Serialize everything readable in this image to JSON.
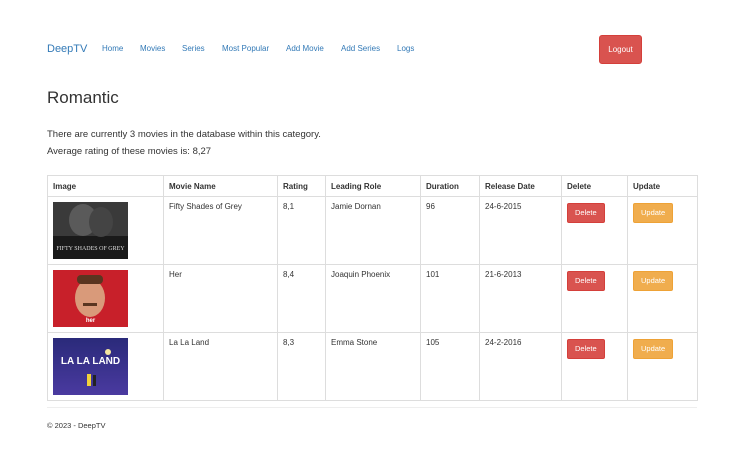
{
  "navbar": {
    "brand": "DeepTV",
    "links": [
      "Home",
      "Movies",
      "Series",
      "Most Popular",
      "Add Movie",
      "Add Series",
      "Logs"
    ],
    "logout_label": "Logout"
  },
  "page": {
    "title": "Romantic",
    "info_count": "There are currently 3 movies in the database within this category.",
    "info_rating": "Average rating of these movies is: 8,27"
  },
  "table": {
    "headers": [
      "Image",
      "Movie Name",
      "Rating",
      "Leading Role",
      "Duration",
      "Release Date",
      "Delete",
      "Update"
    ],
    "rows": [
      {
        "name": "Fifty Shades of Grey",
        "rating": "8,1",
        "role": "Jamie Dornan",
        "duration": "96",
        "release": "24-6-2015",
        "delete": "Delete",
        "update": "Update",
        "poster_text": "FIFTY SHADES OF GREY"
      },
      {
        "name": "Her",
        "rating": "8,4",
        "role": "Joaquin Phoenix",
        "duration": "101",
        "release": "21-6-2013",
        "delete": "Delete",
        "update": "Update",
        "poster_text": "her"
      },
      {
        "name": "La La Land",
        "rating": "8,3",
        "role": "Emma Stone",
        "duration": "105",
        "release": "24-2-2016",
        "delete": "Delete",
        "update": "Update",
        "poster_text": "LA LA LAND"
      }
    ]
  },
  "footer": {
    "text": "© 2023 - DeepTV"
  },
  "colors": {
    "link": "#337ab7",
    "danger": "#d9534f",
    "warning": "#f0ad4e"
  }
}
